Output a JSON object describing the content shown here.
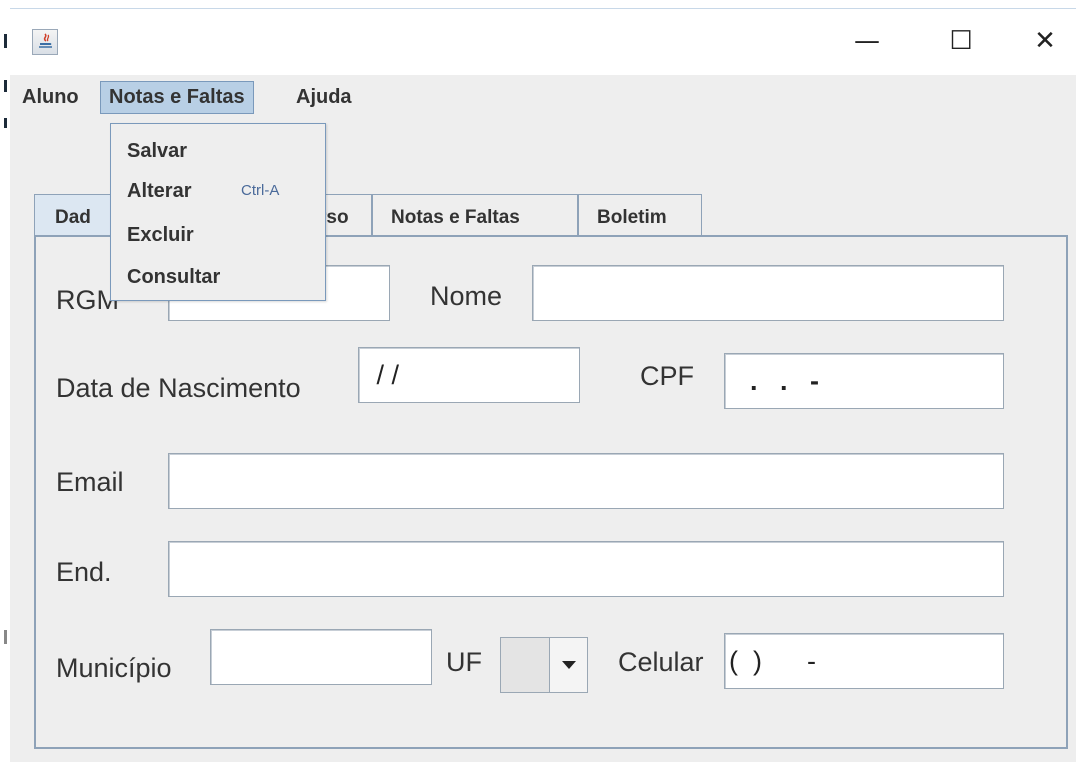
{
  "window": {
    "controls": {
      "minimize": "—",
      "maximize": "☐",
      "close": "✕"
    }
  },
  "menubar": {
    "items": [
      {
        "label": "Aluno"
      },
      {
        "label": "Notas e Faltas"
      },
      {
        "label": "Ajuda"
      }
    ]
  },
  "dropdown": {
    "items": [
      {
        "label": "Salvar",
        "accelerator": ""
      },
      {
        "label": "Alterar",
        "accelerator": "Ctrl-A"
      },
      {
        "label": "Excluir",
        "accelerator": ""
      },
      {
        "label": "Consultar",
        "accelerator": ""
      }
    ]
  },
  "tabs": [
    {
      "label": "Dad"
    },
    {
      "label": "rso"
    },
    {
      "label": "Notas e Faltas"
    },
    {
      "label": "Boletim"
    }
  ],
  "form": {
    "rgm_label": "RGM",
    "nome_label": "Nome",
    "data_label": "Data de Nascimento",
    "data_value": " / /",
    "cpf_label": "CPF",
    "cpf_value": "  .   .   -",
    "email_label": "Email",
    "end_label": "End.",
    "municipio_label": "Município",
    "uf_label": "UF",
    "celular_label": "Celular",
    "celular_value": "(  )      -"
  },
  "colors": {
    "menu_highlight": "#b8cfe5",
    "tab_border": "#8ea2b8",
    "accelerator": "#4a6a9a"
  }
}
